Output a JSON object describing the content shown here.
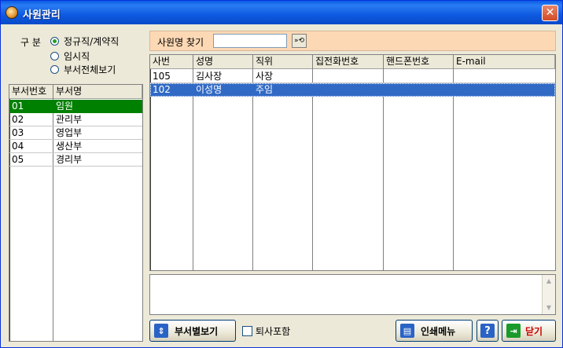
{
  "window": {
    "title": "사원관리",
    "close_glyph": "✕"
  },
  "filter": {
    "label": "구 분",
    "options": [
      {
        "label": "정규직/계약직",
        "selected": true
      },
      {
        "label": "임시직",
        "selected": false
      },
      {
        "label": "부서전체보기",
        "selected": false
      }
    ]
  },
  "departments": {
    "headers": [
      "부서번호",
      "부서명"
    ],
    "rows": [
      {
        "code": "01",
        "name": "임원",
        "selected": true
      },
      {
        "code": "02",
        "name": "관리부",
        "selected": false
      },
      {
        "code": "03",
        "name": "영업부",
        "selected": false
      },
      {
        "code": "04",
        "name": "생산부",
        "selected": false
      },
      {
        "code": "05",
        "name": "경리부",
        "selected": false
      }
    ]
  },
  "search": {
    "label": "사원명 찾기",
    "value": "",
    "button_icon": "search-go-icon",
    "button_glyph": "»⟲"
  },
  "employees": {
    "headers": [
      "사번",
      "성명",
      "직위",
      "집전화번호",
      "핸드폰번호",
      "E-mail"
    ],
    "rows": [
      {
        "cells": [
          "105",
          "김사장",
          "사장",
          "",
          "",
          ""
        ],
        "selected": false
      },
      {
        "cells": [
          "102",
          "이성명",
          "주임",
          "",
          "",
          ""
        ],
        "selected": true
      }
    ]
  },
  "memo": {
    "value": ""
  },
  "bottom": {
    "dept_view_label": "부서별보기",
    "retired_label": "퇴사포함",
    "retired_checked": false,
    "print_label": "인쇄메뉴",
    "help_glyph": "?",
    "close_label": "닫기"
  },
  "colors": {
    "dept_selected_bg": "#008000",
    "emp_selected_bg": "#316ac5",
    "search_bg": "#fdd8b4"
  }
}
